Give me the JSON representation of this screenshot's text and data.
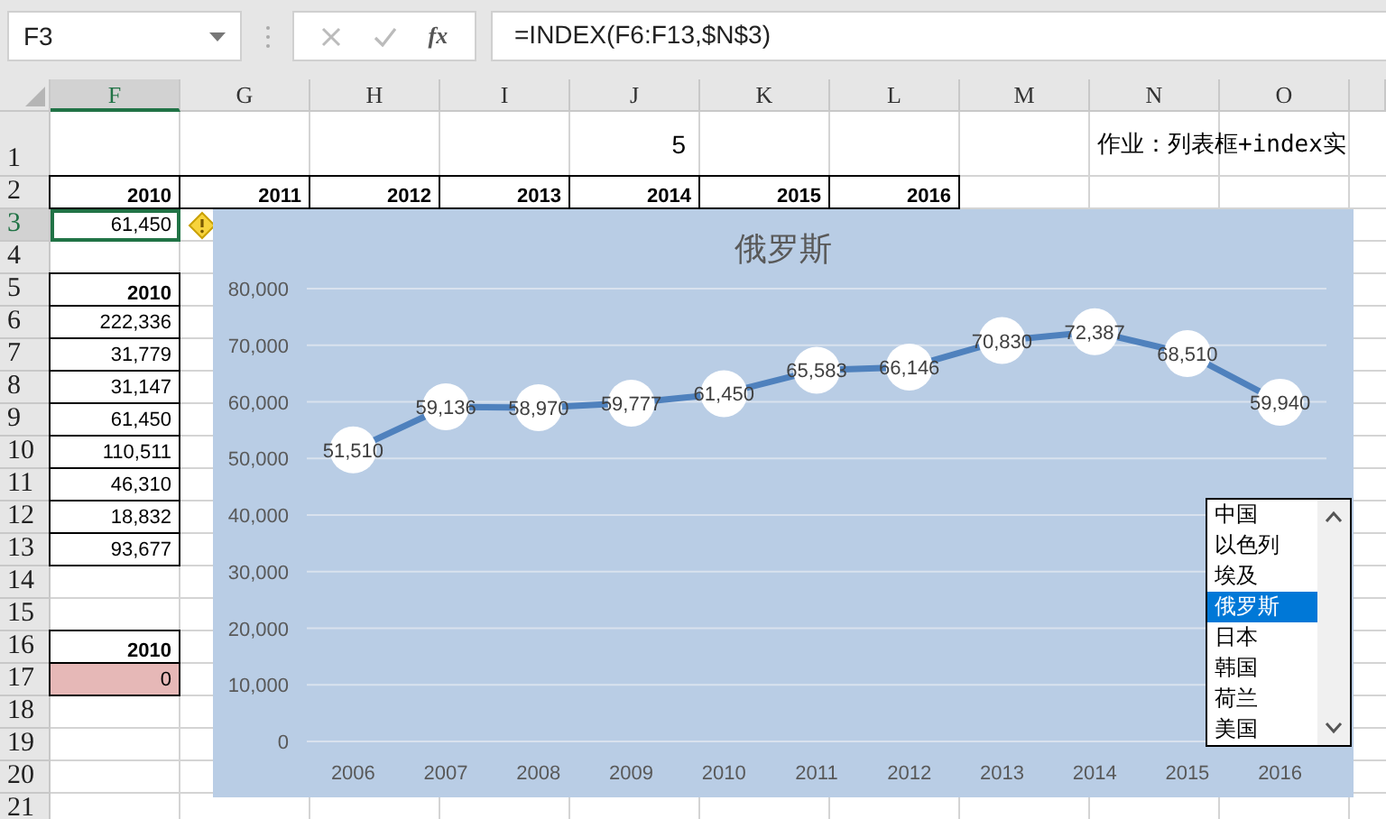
{
  "name_box": "F3",
  "function_label": "fx",
  "formula": "=INDEX(F6:F13,$N$3)",
  "columns": [
    {
      "label": "F",
      "selected": true
    },
    {
      "label": "G",
      "selected": false
    },
    {
      "label": "H",
      "selected": false
    },
    {
      "label": "I",
      "selected": false
    },
    {
      "label": "J",
      "selected": false
    },
    {
      "label": "K",
      "selected": false
    },
    {
      "label": "L",
      "selected": false
    },
    {
      "label": "M",
      "selected": false
    },
    {
      "label": "N",
      "selected": false
    },
    {
      "label": "O",
      "selected": false
    }
  ],
  "sheet_rows": [
    {
      "number": "1",
      "selected": false,
      "cells": [
        {},
        {},
        {},
        {},
        {
          "text": "5",
          "kind": "plain",
          "selected": false
        },
        {},
        {},
        {},
        {
          "text": "作业：列表框+index实",
          "kind": "note",
          "selected": false
        }
      ]
    },
    {
      "number": "2",
      "selected": false,
      "cells": [
        {
          "text": "2010",
          "kind": "header",
          "selected": false
        },
        {
          "text": "2011",
          "kind": "header",
          "selected": false
        },
        {
          "text": "2012",
          "kind": "header",
          "selected": false
        },
        {
          "text": "2013",
          "kind": "header",
          "selected": false
        },
        {
          "text": "2014",
          "kind": "header",
          "selected": false
        },
        {
          "text": "2015",
          "kind": "header",
          "selected": false
        },
        {
          "text": "2016",
          "kind": "header",
          "selected": false
        }
      ]
    },
    {
      "number": "3",
      "selected": true,
      "cells": [
        {
          "text": "61,450",
          "kind": "plain",
          "selected": true
        }
      ]
    },
    {
      "number": "4",
      "selected": false,
      "cells": []
    },
    {
      "number": "5",
      "selected": false,
      "cells": [
        {
          "text": "2010",
          "kind": "header",
          "selected": false
        }
      ]
    },
    {
      "number": "6",
      "selected": false,
      "cells": [
        {
          "text": "222,336",
          "kind": "value",
          "selected": false
        }
      ]
    },
    {
      "number": "7",
      "selected": false,
      "cells": [
        {
          "text": "31,779",
          "kind": "value",
          "selected": false
        }
      ]
    },
    {
      "number": "8",
      "selected": false,
      "cells": [
        {
          "text": "31,147",
          "kind": "value",
          "selected": false
        }
      ]
    },
    {
      "number": "9",
      "selected": false,
      "cells": [
        {
          "text": "61,450",
          "kind": "value",
          "selected": false
        }
      ]
    },
    {
      "number": "10",
      "selected": false,
      "cells": [
        {
          "text": "110,511",
          "kind": "value",
          "selected": false
        }
      ]
    },
    {
      "number": "11",
      "selected": false,
      "cells": [
        {
          "text": "46,310",
          "kind": "value",
          "selected": false
        }
      ]
    },
    {
      "number": "12",
      "selected": false,
      "cells": [
        {
          "text": "18,832",
          "kind": "value",
          "selected": false
        }
      ]
    },
    {
      "number": "13",
      "selected": false,
      "cells": [
        {
          "text": "93,677",
          "kind": "value",
          "selected": false
        }
      ]
    },
    {
      "number": "14",
      "selected": false,
      "cells": []
    },
    {
      "number": "15",
      "selected": false,
      "cells": []
    },
    {
      "number": "16",
      "selected": false,
      "cells": [
        {
          "text": "2010",
          "kind": "header",
          "selected": false
        }
      ]
    },
    {
      "number": "17",
      "selected": false,
      "cells": [
        {
          "text": "0",
          "kind": "highlight",
          "selected": false
        }
      ]
    },
    {
      "number": "18",
      "selected": false,
      "cells": []
    },
    {
      "number": "19",
      "selected": false,
      "cells": []
    },
    {
      "number": "20",
      "selected": false,
      "cells": []
    },
    {
      "number": "21",
      "selected": false,
      "cells": []
    }
  ],
  "chart": {
    "chart_data": {
      "type": "line",
      "title": "俄罗斯",
      "categories": [
        "2006",
        "2007",
        "2008",
        "2009",
        "2010",
        "2011",
        "2012",
        "2013",
        "2014",
        "2015",
        "2016"
      ],
      "series": [
        {
          "color": "#4f81bd",
          "marker": "circle",
          "values": [
            51510,
            59136,
            58970,
            59777,
            61450,
            65583,
            66146,
            70830,
            72387,
            68510,
            59940
          ],
          "value_labels": [
            "51,510",
            "59,136",
            "58,970",
            "59,777",
            "61,450",
            "65,583",
            "66,146",
            "70,830",
            "72,387",
            "68,510",
            "59,940"
          ]
        }
      ],
      "ylim": [
        0,
        80000
      ],
      "yticks": [
        {
          "value": 0,
          "label": "0"
        },
        {
          "value": 10000,
          "label": "10,000"
        },
        {
          "value": 20000,
          "label": "20,000"
        },
        {
          "value": 30000,
          "label": "30,000"
        },
        {
          "value": 40000,
          "label": "40,000"
        },
        {
          "value": 50000,
          "label": "50,000"
        },
        {
          "value": 60000,
          "label": "60,000"
        },
        {
          "value": 70000,
          "label": "70,000"
        },
        {
          "value": 80000,
          "label": "80,000"
        }
      ],
      "grid": true
    }
  },
  "listbox": {
    "items": [
      {
        "label": "中国",
        "selected": false
      },
      {
        "label": "以色列",
        "selected": false
      },
      {
        "label": "埃及",
        "selected": false
      },
      {
        "label": "俄罗斯",
        "selected": true
      },
      {
        "label": "日本",
        "selected": false
      },
      {
        "label": "韩国",
        "selected": false
      },
      {
        "label": "荷兰",
        "selected": false
      },
      {
        "label": "美国",
        "selected": false
      }
    ]
  }
}
